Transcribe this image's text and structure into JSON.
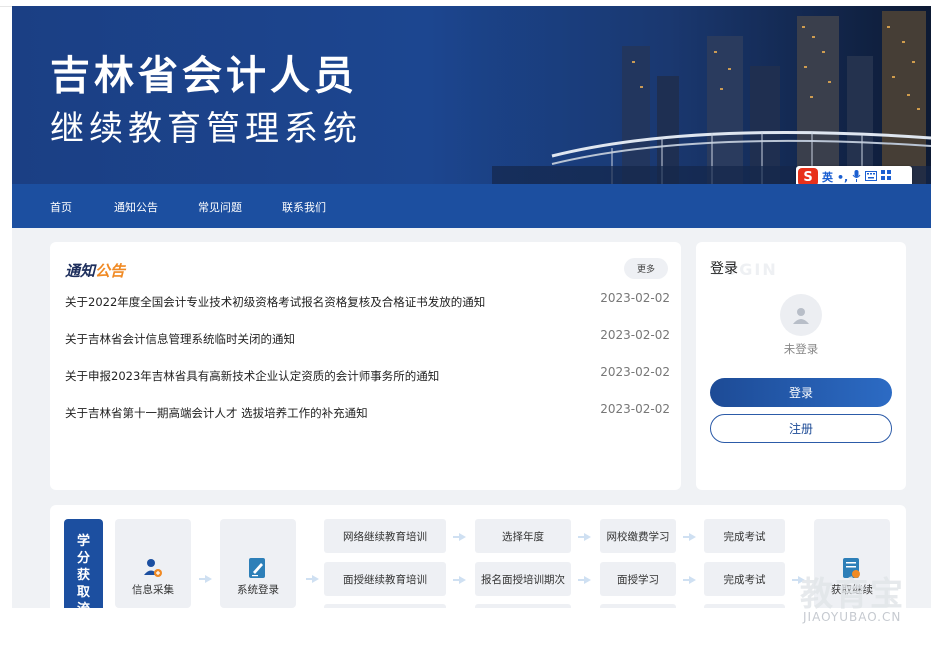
{
  "banner": {
    "title": "吉林省会计人员",
    "subtitle": "继续教育管理系统"
  },
  "ime": {
    "logo": "S",
    "items": [
      "英",
      "•,",
      "mic-icon",
      "keyboard-icon",
      "grid-icon"
    ]
  },
  "nav": {
    "items": [
      "首页",
      "通知公告",
      "常见问题",
      "联系我们"
    ]
  },
  "notice": {
    "title_part1": "通知",
    "title_part2": "公告",
    "more_label": "更多",
    "items": [
      {
        "text": "关于2022年度全国会计专业技术初级资格考试报名资格复核及合格证书发放的通知",
        "date": "2023-02-02"
      },
      {
        "text": "关于吉林省会计信息管理系统临时关闭的通知",
        "date": "2023-02-02"
      },
      {
        "text": "关于申报2023年吉林省具有高新技术企业认定资质的会计师事务所的通知",
        "date": "2023-02-02"
      },
      {
        "text": "关于吉林省第十一期高端会计人才 选拔培养工作的补充通知",
        "date": "2023-02-02"
      }
    ]
  },
  "login": {
    "title": "登录",
    "watermark": "LOGIN",
    "status": "未登录",
    "login_button": "登录",
    "register_button": "注册"
  },
  "process": {
    "label": "学分获取流",
    "cards": [
      "信息采集",
      "系统登录",
      "获取继续"
    ],
    "row1": [
      "网络继续教育培训",
      "选择年度",
      "网校缴费学习",
      "完成考试"
    ],
    "row2": [
      "面授继续教育培训",
      "报名面授培训期次",
      "面授学习",
      "完成考试"
    ]
  },
  "watermark": {
    "main": "教育宝",
    "url": "JIAOYUBAO.CN"
  },
  "colors": {
    "brand_blue": "#1c4fa0",
    "accent_orange": "#f08a24",
    "ime_red": "#e8311a"
  }
}
